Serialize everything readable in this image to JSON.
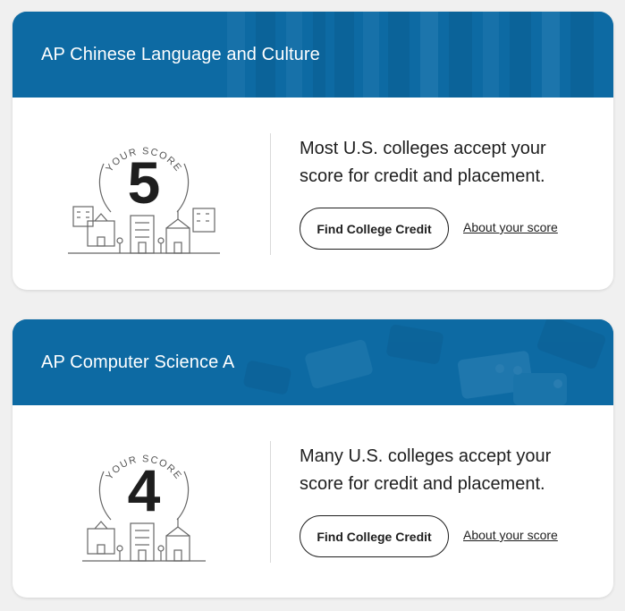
{
  "cards": [
    {
      "title": "AP Chinese Language and Culture",
      "score_label": "YOUR SCORE",
      "score": "5",
      "message": "Most U.S. colleges accept your score for credit and placement.",
      "primary_button": "Find College Credit",
      "secondary_link": "About your score",
      "header_theme": "chinese-scroll-texture",
      "score_icon": "college-buildings-icon"
    },
    {
      "title": "AP Computer Science A",
      "score_label": "YOUR SCORE",
      "score": "4",
      "message": "Many U.S. colleges accept your score for credit and placement.",
      "primary_button": "Find College Credit",
      "secondary_link": "About your score",
      "header_theme": "building-blocks-texture",
      "score_icon": "college-buildings-icon"
    }
  ],
  "colors": {
    "header_blue": "#0d6aa3",
    "page_background": "#f0f0f0",
    "card_background": "#ffffff",
    "text": "#1e1e1e",
    "divider": "#d9d9d9"
  }
}
